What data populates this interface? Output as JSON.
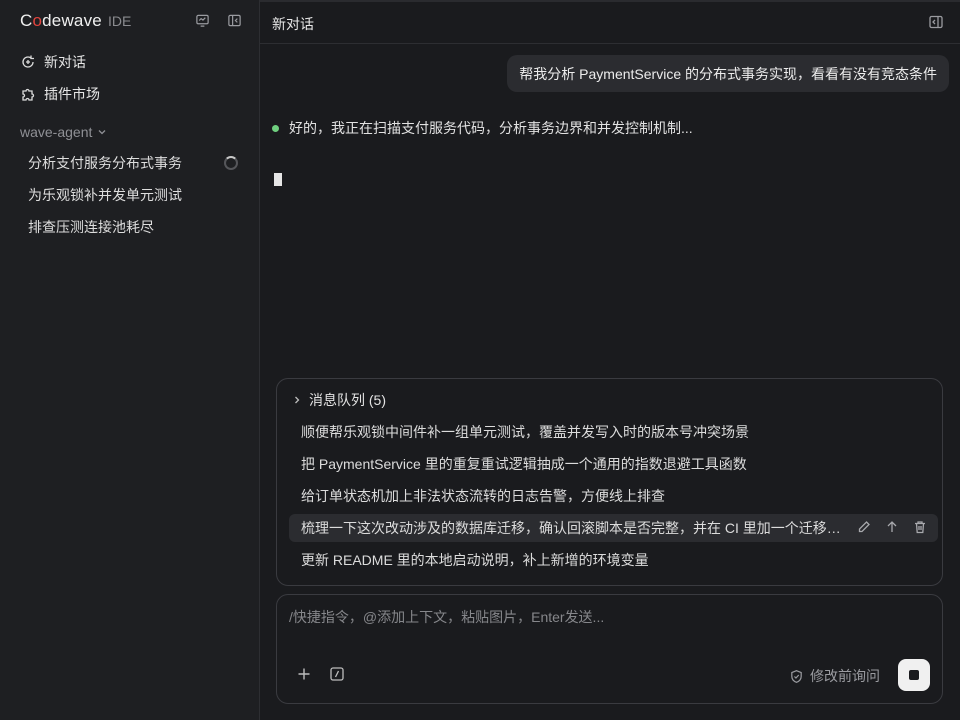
{
  "sidebar": {
    "brand": {
      "name_pre": "C",
      "name_ring": "o",
      "name_post": "dewave",
      "suffix": "IDE"
    },
    "nav": [
      {
        "label": "新对话",
        "icon": "new-chat-icon"
      },
      {
        "label": "插件市场",
        "icon": "puzzle-icon"
      }
    ],
    "group": {
      "title": "wave-agent"
    },
    "conversations": [
      {
        "label": "分析支付服务分布式事务",
        "loading": true
      },
      {
        "label": "为乐观锁补并发单元测试"
      },
      {
        "label": "排查压测连接池耗尽"
      }
    ]
  },
  "header": {
    "title": "新对话"
  },
  "chat": {
    "user_message": "帮我分析 PaymentService 的分布式事务实现，看看有没有竞态条件",
    "assistant_status": "好的，我正在扫描支付服务代码，分析事务边界和并发控制机制..."
  },
  "queue": {
    "title": "消息队列 (5)",
    "items": [
      "顺便帮乐观锁中间件补一组单元测试，覆盖并发写入时的版本号冲突场景",
      "把 PaymentService 里的重复重试逻辑抽成一个通用的指数退避工具函数",
      "给订单状态机加上非法状态流转的日志告警，方便线上排查",
      "梳理一下这次改动涉及的数据库迁移，确认回滚脚本是否完整，并在 CI 里加一个迁移…",
      "更新 README 里的本地启动说明，补上新增的环境变量"
    ]
  },
  "composer": {
    "placeholder": "/快捷指令，@添加上下文，粘贴图片，Enter发送...",
    "ask_label": "修改前询问"
  },
  "colors": {
    "status_dot": "#6fcf7f",
    "brand_accent": "#e0443e"
  }
}
